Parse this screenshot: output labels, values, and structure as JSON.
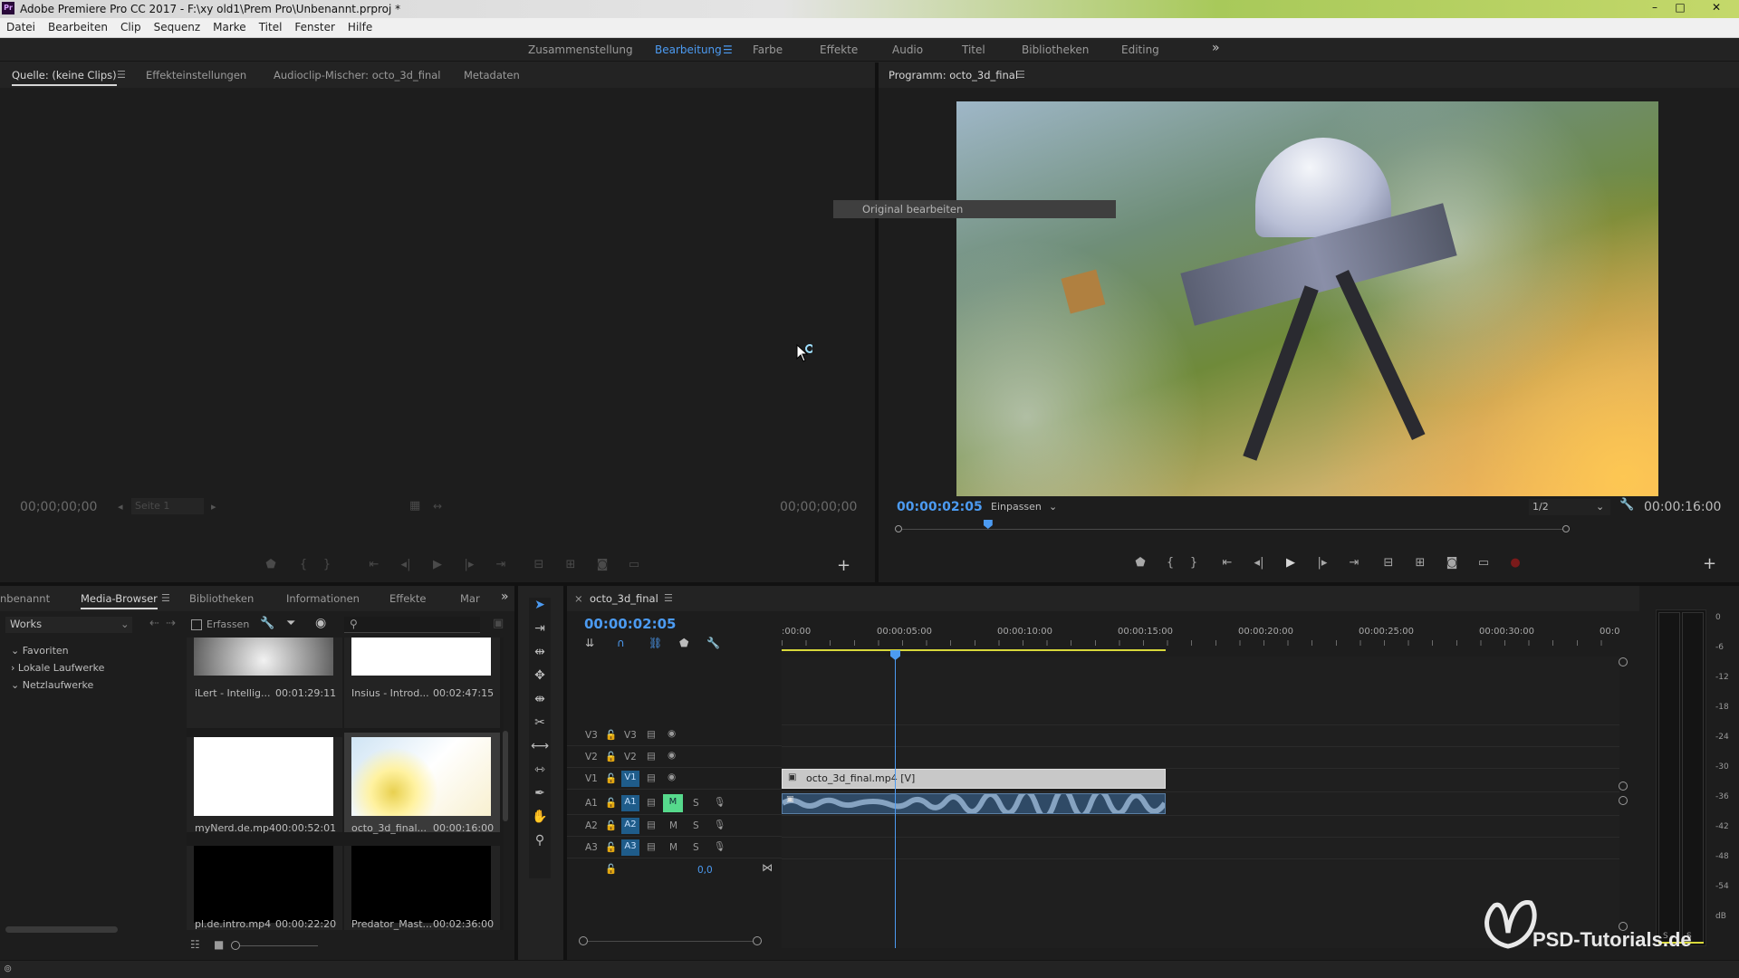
{
  "app": {
    "title": "Adobe Premiere Pro CC 2017 - F:\\xy old1\\Prem Pro\\Unbenannt.prproj *",
    "icon_text": "Pr",
    "window_controls": [
      "–",
      "□",
      "✕"
    ]
  },
  "menu": [
    "Datei",
    "Bearbeiten",
    "Clip",
    "Sequenz",
    "Marke",
    "Titel",
    "Fenster",
    "Hilfe"
  ],
  "workspaces": {
    "items": [
      "Zusammenstellung",
      "Bearbeitung",
      "Farbe",
      "Effekte",
      "Audio",
      "Titel",
      "Bibliotheken",
      "Editing"
    ],
    "active": "Bearbeitung",
    "more": "»"
  },
  "source_panel": {
    "tabs": [
      "Quelle: (keine Clips)",
      "Effekteinstellungen",
      "Audioclip-Mischer: octo_3d_final",
      "Metadaten"
    ],
    "timecode_in": "00;00;00;00",
    "timecode_out": "00;00;00;00",
    "page_select": "Seite 1"
  },
  "program_panel": {
    "title": "Programm: octo_3d_final",
    "timecode": "00:00:02:05",
    "fit": "Einpassen",
    "resolution": "1/2",
    "duration": "00:00:16:00",
    "playhead_fraction": 0.138
  },
  "context_tooltip": "Original bearbeiten",
  "media_browser": {
    "tabs": [
      "nbenannt",
      "Media-Browser",
      "Bibliotheken",
      "Informationen",
      "Effekte",
      "Mar"
    ],
    "active_tab": "Media-Browser",
    "location": "Works",
    "ingest_label": "Erfassen",
    "tree": [
      "Favoriten",
      "Lokale Laufwerke",
      "Netzlaufwerke"
    ],
    "clips": [
      {
        "name": "iLert - Intellig...",
        "duration": "00:01:29:11",
        "style": "gray"
      },
      {
        "name": "Insius - Introd...",
        "duration": "00:02:47:15",
        "style": "white"
      },
      {
        "name": "myNerd.de.mp4",
        "duration": "00:00:52:01",
        "style": "white"
      },
      {
        "name": "octo_3d_final...",
        "duration": "00:00:16:00",
        "style": "bright"
      },
      {
        "name": "pl.de.intro.mp4",
        "duration": "00:00:22:20",
        "style": "black"
      },
      {
        "name": "Predator_Mast...",
        "duration": "00:02:36:00",
        "style": "black"
      }
    ]
  },
  "timeline": {
    "sequence_name": "octo_3d_final",
    "timecode": "00:00:02:05",
    "ruler": [
      ":00:00",
      "00:00:05:00",
      "00:00:10:00",
      "00:00:15:00",
      "00:00:20:00",
      "00:00:25:00",
      "00:00:30:00",
      "00:0"
    ],
    "video_tracks": [
      {
        "target": "V3",
        "name": "V3",
        "active": false
      },
      {
        "target": "V2",
        "name": "V2",
        "active": false
      },
      {
        "target": "V1",
        "name": "V1",
        "active": true
      }
    ],
    "audio_tracks": [
      {
        "target": "A1",
        "name": "A1",
        "mute": "M",
        "solo": "S",
        "mute_on": true
      },
      {
        "target": "A2",
        "name": "A2",
        "mute": "M",
        "solo": "S",
        "mute_on": false
      },
      {
        "target": "A3",
        "name": "A3",
        "mute": "M",
        "solo": "S",
        "mute_on": false
      }
    ],
    "master_value": "0,0",
    "video_clip": "octo_3d_final.mp4 [V]"
  },
  "audio_meter": {
    "scale": [
      "0",
      "-6",
      "-12",
      "-18",
      "-24",
      "-30",
      "-36",
      "-42",
      "-48",
      "-54",
      "dB"
    ],
    "solo_labels": [
      "S",
      "S"
    ]
  },
  "watermark": "PSD-Tutorials.de",
  "colors": {
    "accent": "#4c9bf2",
    "mute_on": "#56d98c",
    "target": "#1f5c8a",
    "work_area": "#d8d83a"
  }
}
